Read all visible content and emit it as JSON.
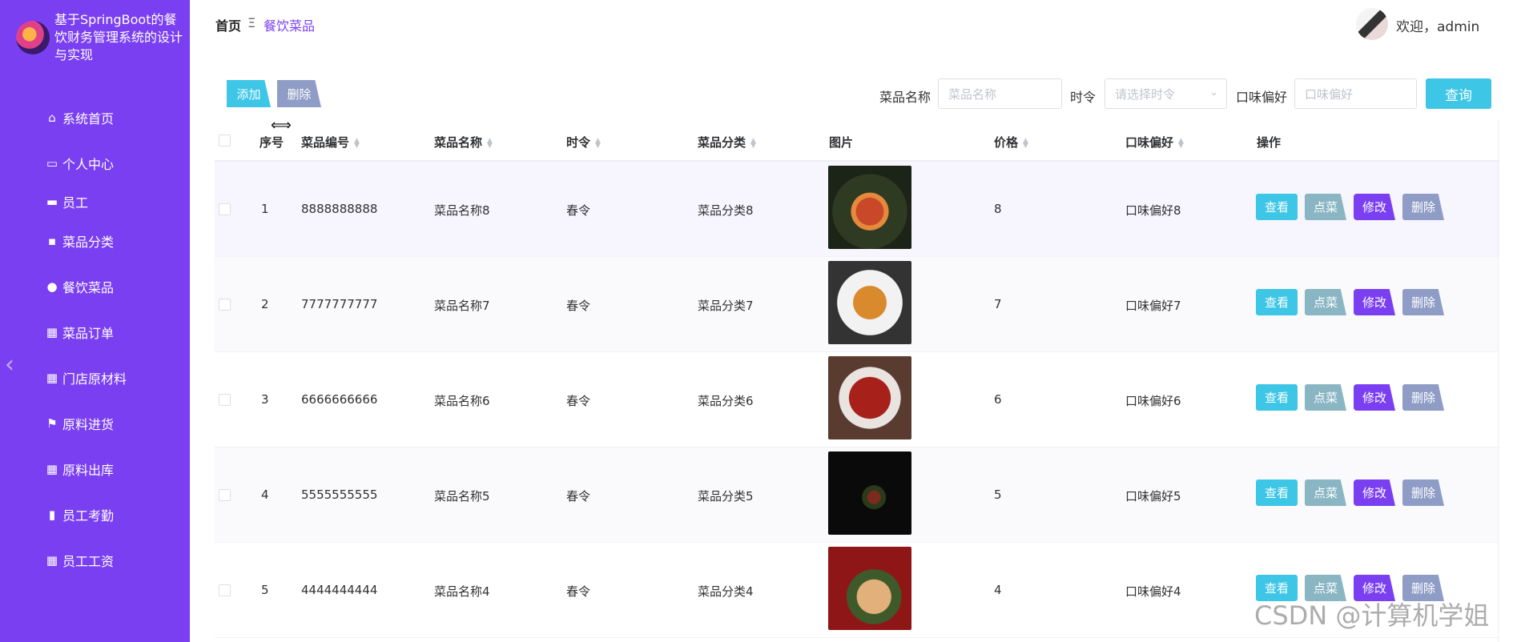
{
  "app": {
    "title": "基于SpringBoot的餐饮财务管理系统的设计与实现"
  },
  "sidebar": {
    "items": [
      {
        "label": "系统首页",
        "icon": "home-icon",
        "glyph": "⌂"
      },
      {
        "label": "个人中心",
        "icon": "card-icon",
        "glyph": "▭"
      },
      {
        "label": "员工",
        "icon": "ticket-icon",
        "glyph": "▬"
      },
      {
        "label": "菜品分类",
        "icon": "briefcase-icon",
        "glyph": "▪"
      },
      {
        "label": "餐饮菜品",
        "icon": "bulb-icon",
        "glyph": "●"
      },
      {
        "label": "菜品订单",
        "icon": "grid-icon",
        "glyph": "▦"
      },
      {
        "label": "门店原材料",
        "icon": "grid-icon",
        "glyph": "▦"
      },
      {
        "label": "原料进货",
        "icon": "flag-icon",
        "glyph": "⚑"
      },
      {
        "label": "原料出库",
        "icon": "grid-icon",
        "glyph": "▦"
      },
      {
        "label": "员工考勤",
        "icon": "chart-icon",
        "glyph": "▮"
      },
      {
        "label": "员工工资",
        "icon": "grid-icon",
        "glyph": "▦"
      }
    ]
  },
  "header": {
    "breadcrumb_home": "首页",
    "breadcrumb_sep": "Ξ",
    "breadcrumb_current": "餐饮菜品",
    "welcome": "欢迎，admin"
  },
  "toolbar": {
    "add_label": "添加",
    "delete_label": "删除"
  },
  "search": {
    "name_label": "菜品名称",
    "name_placeholder": "菜品名称",
    "season_label": "时令",
    "season_placeholder": "请选择时令",
    "taste_label": "口味偏好",
    "taste_placeholder": "口味偏好",
    "query_label": "查询"
  },
  "table": {
    "headers": {
      "index": "序号",
      "code": "菜品编号",
      "name": "菜品名称",
      "season": "时令",
      "category": "菜品分类",
      "image": "图片",
      "price": "价格",
      "taste": "口味偏好",
      "ops": "操作"
    },
    "actions": {
      "view": "查看",
      "order": "点菜",
      "edit": "修改",
      "delete": "删除"
    },
    "rows": [
      {
        "index": "1",
        "code": "8888888888",
        "name": "菜品名称8",
        "season": "春令",
        "category": "菜品分类8",
        "price": "8",
        "taste": "口味偏好8"
      },
      {
        "index": "2",
        "code": "7777777777",
        "name": "菜品名称7",
        "season": "春令",
        "category": "菜品分类7",
        "price": "7",
        "taste": "口味偏好7"
      },
      {
        "index": "3",
        "code": "6666666666",
        "name": "菜品名称6",
        "season": "春令",
        "category": "菜品分类6",
        "price": "6",
        "taste": "口味偏好6"
      },
      {
        "index": "4",
        "code": "5555555555",
        "name": "菜品名称5",
        "season": "春令",
        "category": "菜品分类5",
        "price": "5",
        "taste": "口味偏好5"
      },
      {
        "index": "5",
        "code": "4444444444",
        "name": "菜品名称4",
        "season": "春令",
        "category": "菜品分类4",
        "price": "4",
        "taste": "口味偏好4"
      }
    ]
  },
  "watermark": "CSDN @计算机学姐",
  "colors": {
    "sidebar": "#7b3ff2",
    "accent": "#3ec6e6",
    "muted": "#8f9dc6"
  }
}
